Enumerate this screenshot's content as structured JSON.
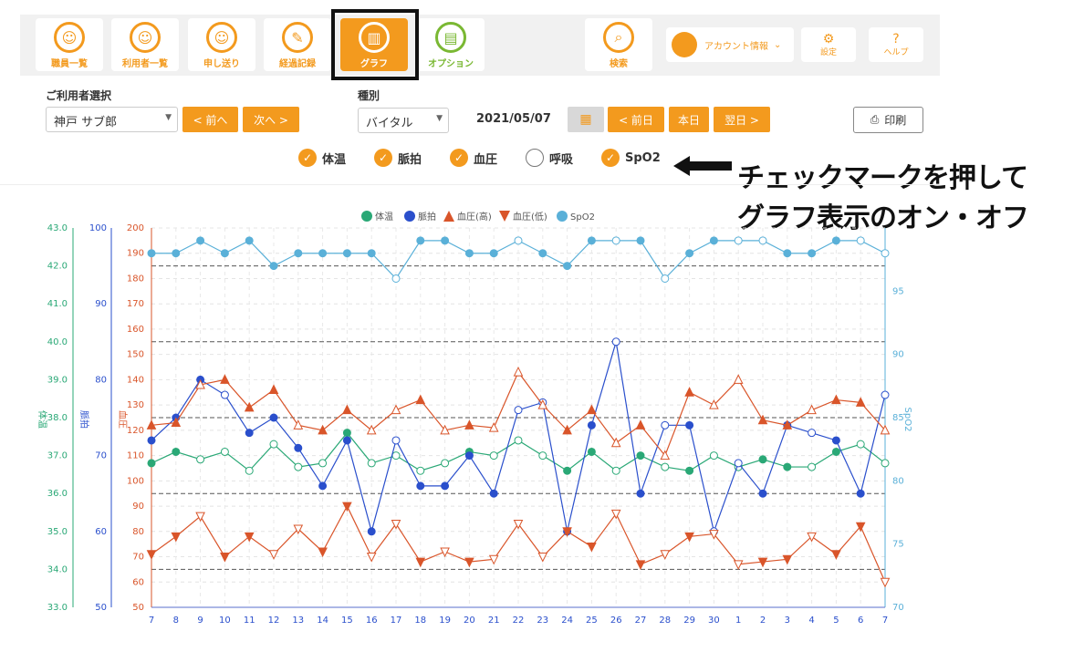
{
  "nav": {
    "items": [
      {
        "label": "職員一覧",
        "icon": "staff-icon",
        "glyph": "☺"
      },
      {
        "label": "利用者一覧",
        "icon": "users-icon",
        "glyph": "☺"
      },
      {
        "label": "申し送り",
        "icon": "handover-icon",
        "glyph": "☺"
      },
      {
        "label": "経過記録",
        "icon": "record-icon",
        "glyph": "✎"
      },
      {
        "label": "グラフ",
        "icon": "graph-icon",
        "glyph": "▥"
      },
      {
        "label": "オプション",
        "icon": "book-icon",
        "glyph": "▤"
      }
    ],
    "search": {
      "label": "検索",
      "glyph": "⌕"
    },
    "account": {
      "label": "アカウント情報",
      "caret": "⌄"
    },
    "settings": {
      "label": "設定",
      "glyph": "⚙"
    },
    "help": {
      "label": "ヘルプ",
      "glyph": "?"
    }
  },
  "controls": {
    "user_label": "ご利用者選択",
    "user_value": "神戸 サブ郎",
    "prev_label": "< 前へ",
    "next_label": "次へ >",
    "type_label": "種別",
    "type_value": "バイタル",
    "date": "2021/05/07",
    "prev_day": "< 前日",
    "today": "本日",
    "next_day": "翌日 >",
    "print": "印刷",
    "select_arrow": "▼",
    "calendar_glyph": "▦",
    "print_glyph": "⎙",
    "check_glyph": "✓"
  },
  "checks": [
    {
      "label": "体温",
      "checked": true
    },
    {
      "label": "脈拍",
      "checked": true
    },
    {
      "label": "血圧",
      "checked": true
    },
    {
      "label": "呼吸",
      "checked": false
    },
    {
      "label": "SpO2",
      "checked": true
    }
  ],
  "annotation": {
    "line1": "チェックマークを押して",
    "line2": "グラフ表示のオン・オフ"
  },
  "colors": {
    "orange": "#f39a1e",
    "green": "#7ab833",
    "temp": "#2aa876",
    "pulse": "#2a4fcc",
    "bp": "#d9552a",
    "spo2": "#5ab0d8"
  },
  "chart_data": {
    "type": "line",
    "x": [
      "7",
      "8",
      "9",
      "10",
      "11",
      "12",
      "13",
      "14",
      "15",
      "16",
      "17",
      "18",
      "19",
      "20",
      "21",
      "22",
      "23",
      "24",
      "25",
      "26",
      "27",
      "28",
      "29",
      "30",
      "1",
      "2",
      "3",
      "4",
      "5",
      "6",
      "7"
    ],
    "legend": [
      "体温",
      "脈拍",
      "血圧(高)",
      "血圧(低)",
      "SpO2"
    ],
    "axes": {
      "temp": {
        "label": "体温",
        "range": [
          33.0,
          43.0
        ],
        "ticks": [
          "33.0",
          "34.0",
          "35.0",
          "36.0",
          "37.0",
          "38.0",
          "39.0",
          "40.0",
          "41.0",
          "42.0",
          "43.0"
        ]
      },
      "pulse": {
        "label": "脈拍",
        "range": [
          50,
          100
        ],
        "ticks": [
          "50",
          "60",
          "70",
          "80",
          "90",
          "100"
        ]
      },
      "bp": {
        "label": "血圧",
        "range": [
          50,
          200
        ],
        "ticks": [
          "50",
          "60",
          "70",
          "80",
          "90",
          "100",
          "110",
          "120",
          "130",
          "140",
          "150",
          "160",
          "170",
          "180",
          "190",
          "200"
        ]
      },
      "spo2": {
        "label": "SpO2",
        "range": [
          70,
          100
        ],
        "ticks": [
          "70",
          "75",
          "80",
          "85",
          "90",
          "95"
        ]
      }
    },
    "reference_lines": [
      {
        "axis": "bp",
        "values": [
          185,
          155,
          125,
          95,
          65
        ]
      }
    ],
    "series": [
      {
        "name": "体温",
        "axis": "temp",
        "marker": "circle",
        "values": [
          36.8,
          37.1,
          36.9,
          37.1,
          36.6,
          37.3,
          36.7,
          36.8,
          37.6,
          36.8,
          37.0,
          36.6,
          36.8,
          37.1,
          37.0,
          37.4,
          37.0,
          36.6,
          37.1,
          36.6,
          37.0,
          36.7,
          36.6,
          37.0,
          36.7,
          36.9,
          36.7,
          36.7,
          37.1,
          37.3,
          36.8
        ],
        "hollow": [
          false,
          false,
          true,
          true,
          true,
          true,
          true,
          true,
          false,
          true,
          true,
          true,
          true,
          false,
          true,
          true,
          true,
          false,
          false,
          true,
          false,
          true,
          false,
          true,
          true,
          false,
          false,
          true,
          false,
          true,
          true
        ]
      },
      {
        "name": "脈拍",
        "axis": "pulse",
        "marker": "circle",
        "values": [
          72,
          75,
          80,
          78,
          73,
          75,
          71,
          66,
          72,
          60,
          72,
          66,
          66,
          70,
          65,
          76,
          77,
          60,
          74,
          85,
          65,
          74,
          74,
          60,
          69,
          65,
          74,
          73,
          72,
          65,
          78
        ],
        "hollow": [
          false,
          false,
          false,
          true,
          false,
          false,
          false,
          false,
          false,
          false,
          true,
          false,
          false,
          false,
          false,
          true,
          true,
          false,
          false,
          true,
          false,
          true,
          false,
          true,
          true,
          false,
          false,
          true,
          false,
          false,
          true
        ]
      },
      {
        "name": "血圧(高)",
        "axis": "bp",
        "marker": "triangle-up",
        "values": [
          122,
          123,
          138,
          140,
          129,
          136,
          122,
          120,
          128,
          120,
          128,
          132,
          120,
          122,
          121,
          143,
          130,
          120,
          128,
          115,
          122,
          110,
          135,
          130,
          140,
          124,
          122,
          128,
          132,
          131,
          120
        ],
        "hollow": [
          false,
          false,
          true,
          false,
          false,
          false,
          true,
          false,
          false,
          true,
          true,
          false,
          true,
          false,
          true,
          true,
          true,
          false,
          false,
          true,
          false,
          true,
          false,
          true,
          true,
          false,
          false,
          true,
          false,
          false,
          true
        ]
      },
      {
        "name": "血圧(低)",
        "axis": "bp",
        "marker": "triangle-down",
        "values": [
          71,
          78,
          86,
          70,
          78,
          71,
          81,
          72,
          90,
          70,
          83,
          68,
          72,
          68,
          69,
          83,
          70,
          80,
          74,
          87,
          67,
          71,
          78,
          79,
          67,
          68,
          69,
          78,
          71,
          82,
          60
        ],
        "hollow": [
          false,
          false,
          true,
          false,
          false,
          true,
          true,
          false,
          false,
          true,
          true,
          false,
          true,
          false,
          true,
          true,
          true,
          false,
          false,
          true,
          false,
          true,
          false,
          true,
          true,
          false,
          false,
          true,
          false,
          false,
          true
        ]
      },
      {
        "name": "SpO2",
        "axis": "spo2",
        "marker": "circle",
        "values": [
          98,
          98,
          99,
          98,
          99,
          97,
          98,
          98,
          98,
          98,
          96,
          99,
          99,
          98,
          98,
          99,
          98,
          97,
          99,
          99,
          99,
          96,
          98,
          99,
          99,
          99,
          98,
          98,
          99,
          99,
          98
        ],
        "hollow": [
          false,
          false,
          false,
          false,
          false,
          false,
          false,
          false,
          false,
          false,
          true,
          false,
          false,
          false,
          false,
          true,
          false,
          false,
          false,
          true,
          false,
          true,
          false,
          false,
          true,
          true,
          false,
          false,
          false,
          true,
          true
        ]
      }
    ]
  }
}
